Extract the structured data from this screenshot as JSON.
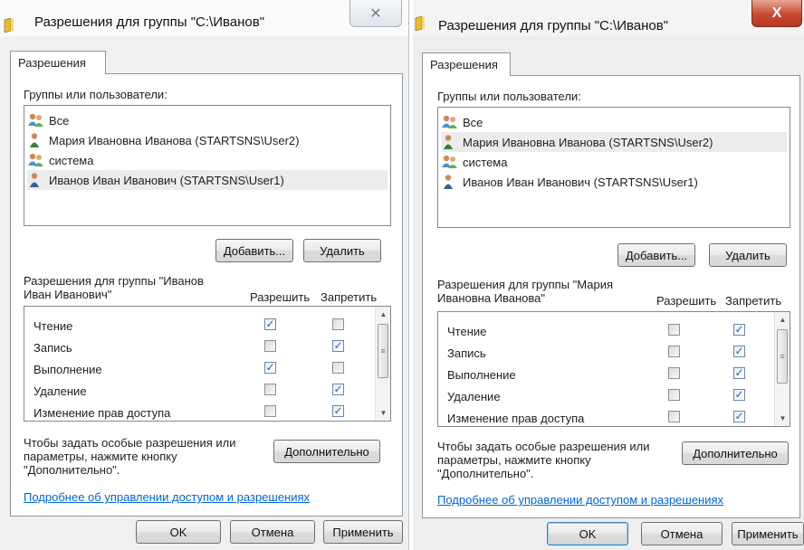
{
  "left_dialog": {
    "title": "Разрешения для группы \"C:\\Иванов\"",
    "close_glyph": "✕",
    "tab_label": "Разрешения",
    "groups_label": "Группы или пользователи:",
    "principals": [
      {
        "name": "Все",
        "icon": "group-icon"
      },
      {
        "name": "Мария Ивановна Иванова (STARTSNS\\User2)",
        "icon": "user-icon"
      },
      {
        "name": "система",
        "icon": "group-icon"
      },
      {
        "name": "Иванов Иван Иванович (STARTSNS\\User1)",
        "icon": "user-icon",
        "selected": true
      }
    ],
    "add_button": "Добавить...",
    "remove_button": "Удалить",
    "perm_header_line1": "Разрешения для группы \"Иванов",
    "perm_header_line2": "Иван Иванович\"",
    "allow_header": "Разрешить",
    "deny_header": "Запретить",
    "permissions": [
      {
        "name": "Чтение",
        "allow": true,
        "deny": false
      },
      {
        "name": "Запись",
        "allow": false,
        "deny": true
      },
      {
        "name": "Выполнение",
        "allow": true,
        "deny": false
      },
      {
        "name": "Удаление",
        "allow": false,
        "deny": true
      },
      {
        "name": "Изменение прав доступа",
        "allow": false,
        "deny": true
      }
    ],
    "special_line1": "Чтобы задать особые разрешения или",
    "special_line2": "параметры, нажмите кнопку",
    "special_line3": "\"Дополнительно\".",
    "advanced_button": "Дополнительно",
    "help_link": "Подробнее об управлении доступом и разрешениях",
    "ok_button": "OK",
    "cancel_button": "Отмена",
    "apply_button": "Применить"
  },
  "right_dialog": {
    "title": "Разрешения для группы \"C:\\Иванов\"",
    "close_glyph": "X",
    "tab_label": "Разрешения",
    "groups_label": "Группы или пользователи:",
    "principals": [
      {
        "name": "Все",
        "icon": "group-icon"
      },
      {
        "name": "Мария Ивановна Иванова (STARTSNS\\User2)",
        "icon": "user-icon",
        "selected": true
      },
      {
        "name": "система",
        "icon": "group-icon"
      },
      {
        "name": "Иванов Иван Иванович (STARTSNS\\User1)",
        "icon": "user-icon"
      }
    ],
    "add_button": "Добавить...",
    "remove_button": "Удалить",
    "perm_header_line1": "Разрешения для группы \"Мария",
    "perm_header_line2": "Ивановна Иванова\"",
    "allow_header": "Разрешить",
    "deny_header": "Запретить",
    "permissions": [
      {
        "name": "Чтение",
        "allow": false,
        "deny": true
      },
      {
        "name": "Запись",
        "allow": false,
        "deny": true
      },
      {
        "name": "Выполнение",
        "allow": false,
        "deny": true
      },
      {
        "name": "Удаление",
        "allow": false,
        "deny": true
      },
      {
        "name": "Изменение прав доступа",
        "allow": false,
        "deny": true
      }
    ],
    "special_line1": "Чтобы задать особые разрешения или",
    "special_line2": "параметры, нажмите кнопку",
    "special_line3": "\"Дополнительно\".",
    "advanced_button": "Дополнительно",
    "help_link": "Подробнее об управлении доступом и разрешениях",
    "ok_button": "OK",
    "cancel_button": "Отмена",
    "apply_button": "Применить"
  },
  "colors": {
    "link": "#0066cc",
    "check": "#2a5ea8",
    "close_active": "#c84a30"
  }
}
